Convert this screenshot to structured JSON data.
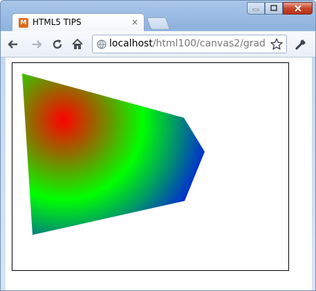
{
  "tab": {
    "title": "HTML5 TIPS",
    "favicon_letter": "M",
    "close_glyph": "×"
  },
  "window_controls": {
    "minimize": "minimize",
    "maximize": "maximize",
    "close": "close"
  },
  "toolbar": {
    "back_icon": "back-arrow-icon",
    "forward_icon": "forward-arrow-icon",
    "reload_icon": "reload-icon",
    "home_icon": "home-icon",
    "wrench_icon": "wrench-icon"
  },
  "omnibox": {
    "url_host": "localhost",
    "url_path": "/html100/canvas2/grad",
    "bookmark_icon": "star-icon"
  },
  "canvas": {
    "shape": "polygon with radial gradient fill",
    "gradient_stops": [
      {
        "offset": 0.0,
        "color": "#ff0000"
      },
      {
        "offset": 0.5,
        "color": "#00ff00"
      },
      {
        "offset": 1.0,
        "color": "#0000ff"
      }
    ],
    "border_color": "#000000"
  }
}
